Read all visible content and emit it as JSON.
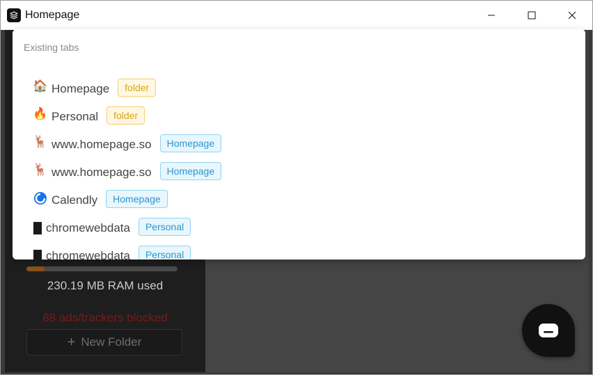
{
  "window": {
    "title": "Homepage",
    "controls": {
      "minimize": "—",
      "maximize": "☐",
      "close": "✕"
    }
  },
  "sidebar": {
    "ram_text": "230.19 MB RAM used",
    "ram_fraction": 0.12,
    "ads_text": "88 ads/trackers blocked",
    "new_folder_label": "New Folder",
    "new_folder_icon": "plus-icon"
  },
  "popup": {
    "header": "Existing tabs",
    "tabs": [
      {
        "icon": "house-icon",
        "glyph": "🏠",
        "title": "Homepage",
        "badge": "folder",
        "badge_type": "folder"
      },
      {
        "icon": "fire-icon",
        "glyph": "🔥",
        "title": "Personal",
        "badge": "folder",
        "badge_type": "folder"
      },
      {
        "icon": "deer-icon",
        "glyph": "🦌",
        "title": "www.homepage.so",
        "badge": "Homepage",
        "badge_type": "space"
      },
      {
        "icon": "deer-icon",
        "glyph": "🦌",
        "title": "www.homepage.so",
        "badge": "Homepage",
        "badge_type": "space"
      },
      {
        "icon": "calendly-icon",
        "glyph": "",
        "title": "Calendly",
        "badge": "Homepage",
        "badge_type": "space"
      },
      {
        "icon": "black-block-icon",
        "glyph": "",
        "title": "chromewebdata",
        "badge": "Personal",
        "badge_type": "space"
      },
      {
        "icon": "black-block-icon",
        "glyph": "",
        "title": "chromewebdata",
        "badge": "Personal",
        "badge_type": "space"
      }
    ]
  },
  "colors": {
    "folder_badge": "#d8a31a",
    "space_badge": "#2a96cf",
    "ads_text": "#7a1a1a"
  }
}
